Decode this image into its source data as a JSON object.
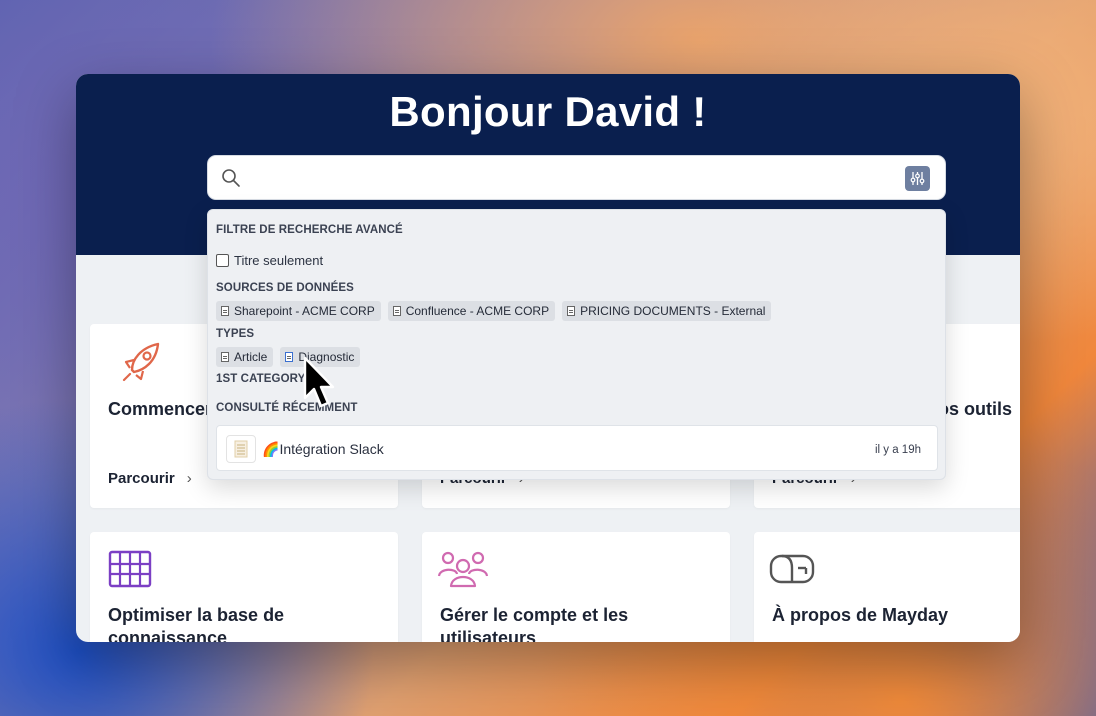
{
  "header": {
    "greeting": "Bonjour David !"
  },
  "search": {
    "placeholder": "",
    "filter_icon": "sliders-icon"
  },
  "dropdown": {
    "title": "FILTRE DE RECHERCHE AVANCÉ",
    "title_only_label": "Titre seulement",
    "sources_heading": "SOURCES DE DONNÉES",
    "sources": [
      "Sharepoint - ACME CORP",
      "Confluence - ACME CORP",
      "PRICING DOCUMENTS - External"
    ],
    "types_heading": "TYPES",
    "types": [
      "Article",
      "Diagnostic"
    ],
    "category_heading": "1ST CATEGORY",
    "recent_heading": "CONSULTÉ RÉCEMMENT",
    "recent": [
      {
        "emoji": "🌈",
        "title": "Intégration Slack",
        "time": "il y a 19h"
      }
    ]
  },
  "cards": [
    {
      "title": "Commencer",
      "link": "Parcourir",
      "icon": "rocket-icon"
    },
    {
      "title": "",
      "link": "Parcourir"
    },
    {
      "title": "os outils",
      "link": "Parcourir"
    },
    {
      "title": "Optimiser la base de connaissance",
      "icon": "abacus-icon"
    },
    {
      "title": "Gérer le compte et les utilisateurs",
      "icon": "users-icon"
    },
    {
      "title": "À propos de Mayday",
      "icon": "mailbox-icon"
    }
  ],
  "colors": {
    "header_bg": "#0a1f4e",
    "accent_orange": "#e0674a",
    "accent_purple": "#7b3fc4",
    "accent_pink": "#d06ab0"
  }
}
